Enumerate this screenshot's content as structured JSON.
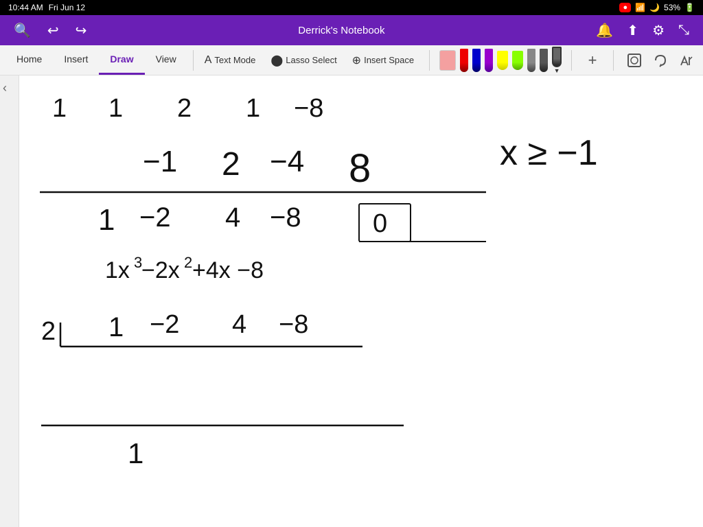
{
  "statusBar": {
    "time": "10:44 AM",
    "date": "Fri Jun 12",
    "recording": "●",
    "wifi": "WiFi",
    "battery": "53%"
  },
  "appTitle": "Derrick's Notebook",
  "navTabs": [
    {
      "label": "Home",
      "active": false
    },
    {
      "label": "Insert",
      "active": false
    },
    {
      "label": "Draw",
      "active": true
    },
    {
      "label": "View",
      "active": false
    }
  ],
  "tools": {
    "textMode": "Text Mode",
    "lassoSelect": "Lasso Select",
    "insertSpace": "Insert Space"
  },
  "sidebarToggle": "‹"
}
